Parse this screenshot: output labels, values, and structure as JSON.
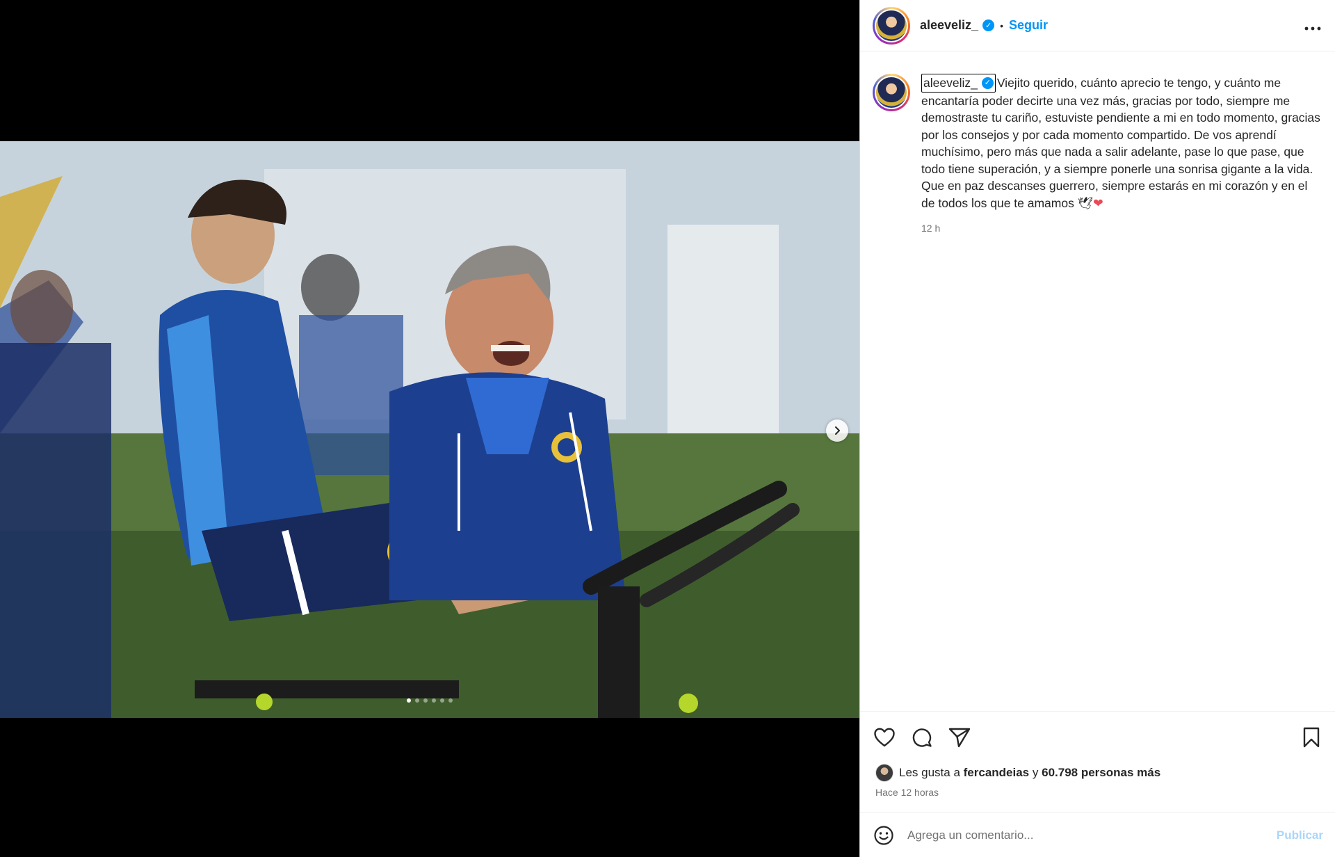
{
  "media": {
    "carousel_total": 6,
    "carousel_active_index": 0
  },
  "header": {
    "username": "aleeveliz_",
    "separator": "•",
    "follow_label": "Seguir",
    "more_icon": "more-horizontal-icon"
  },
  "caption": {
    "username": "aleeveliz_",
    "paragraph1": "Viejito querido, cuánto aprecio te tengo, y cuánto me encantaría poder decirte una vez más, gracias por todo, siempre me demostraste tu cariño, estuviste pendiente a mi en todo momento, gracias por los consejos y por cada momento compartido. De vos aprendí muchísimo, pero más que nada a salir adelante, pase lo que pase, que todo tiene superación, y a siempre ponerle una sonrisa gigante a la vida.",
    "paragraph2": "Que en paz descanses guerrero, siempre estarás en mi corazón y en el de todos los que te amamos",
    "emoji_dove": "🕊",
    "emoji_heart": "❤",
    "time": "12 h"
  },
  "likes": {
    "prefix": "Les gusta a",
    "user": "fercandeias",
    "conj": "y",
    "count_text": "60.798 personas más",
    "posted": "Hace 12 horas"
  },
  "comment": {
    "placeholder": "Agrega un comentario...",
    "publish_label": "Publicar"
  },
  "colors": {
    "accent": "#0095f6",
    "publish_disabled": "#a9d6fb",
    "secondary_text": "#737373"
  }
}
